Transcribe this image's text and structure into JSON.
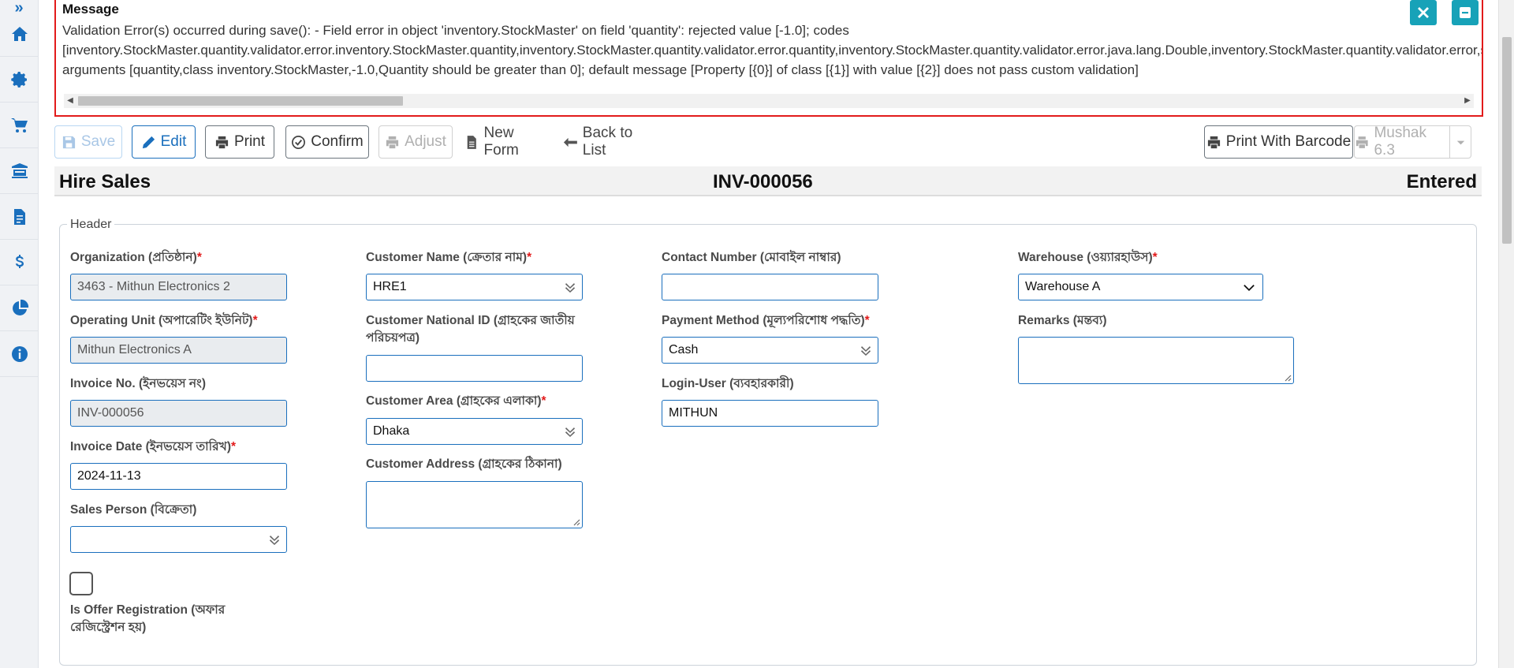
{
  "message": {
    "title": "Message",
    "line1": "Validation Error(s) occurred during save(): - Field error in object 'inventory.StockMaster' on field 'quantity': rejected value [-1.0]; codes",
    "line2": "[inventory.StockMaster.quantity.validator.error.inventory.StockMaster.quantity,inventory.StockMaster.quantity.validator.error.quantity,inventory.StockMaster.quantity.validator.error.java.lang.Double,inventory.StockMaster.quantity.validator.error,stc",
    "line3": "arguments [quantity,class inventory.StockMaster,-1.0,Quantity should be greater than 0]; default message [Property [{0}] of class [{1}] with value [{2}] does not pass custom validation]"
  },
  "toolbar": {
    "save": "Save",
    "edit": "Edit",
    "print": "Print",
    "confirm": "Confirm",
    "adjust": "Adjust",
    "new_form": "New Form",
    "back_to_list": "Back to List",
    "print_with_barcode": "Print With Barcode",
    "mushak": "Mushak 6.3"
  },
  "title": {
    "left": "Hire Sales",
    "center": "INV-000056",
    "right": "Entered"
  },
  "form": {
    "legend": "Header",
    "organization": {
      "label": "Organization (প্রতিষ্ঠান)",
      "value": "3463 - Mithun Electronics 2"
    },
    "operating_unit": {
      "label": "Operating Unit (অপারেটিং ইউনিট)",
      "value": "Mithun Electronics A"
    },
    "invoice_no": {
      "label": "Invoice No. (ইনভয়েস নং)",
      "value": "INV-000056"
    },
    "invoice_date": {
      "label": "Invoice Date (ইনভয়েস তারিখ)",
      "value": "2024-11-13"
    },
    "sales_person": {
      "label": "Sales Person (বিক্রেতা)",
      "value": ""
    },
    "offer_registration": {
      "label_line1": "Is Offer Registration (অফার",
      "label_line2": "রেজিস্ট্রেশন হয়)"
    },
    "customer_name": {
      "label": "Customer Name (ক্রেতার নাম)",
      "value": "HRE1"
    },
    "customer_national_id": {
      "label_line1": "Customer National ID (গ্রাহকের জাতীয়",
      "label_line2": "পরিচয়পত্র)",
      "value": ""
    },
    "customer_area": {
      "label": "Customer Area (গ্রাহকের এলাকা)",
      "value": "Dhaka"
    },
    "customer_address": {
      "label": "Customer Address (গ্রাহকের ঠিকানা)",
      "value": ""
    },
    "contact_number": {
      "label": "Contact Number (মোবাইল নাম্বার)",
      "value": ""
    },
    "payment_method": {
      "label": "Payment Method (মূল্যপরিশোধ পদ্ধতি)",
      "value": "Cash"
    },
    "login_user": {
      "label": "Login-User (ব্যবহারকারী)",
      "value": "MITHUN"
    },
    "warehouse": {
      "label": "Warehouse (ওয়্যারহাউস)",
      "value": "Warehouse A"
    },
    "remarks": {
      "label": "Remarks (মন্তব্য)",
      "value": ""
    }
  },
  "colors": {
    "accent": "#1a6fbd",
    "error_border": "#e21b1b",
    "message_buttons": "#17a2b8"
  },
  "icons": {
    "sidebar": [
      "home-icon",
      "gear-icon",
      "cart-icon",
      "bank-icon",
      "invoice-icon",
      "dollar-icon",
      "pie-chart-icon",
      "info-icon"
    ]
  }
}
